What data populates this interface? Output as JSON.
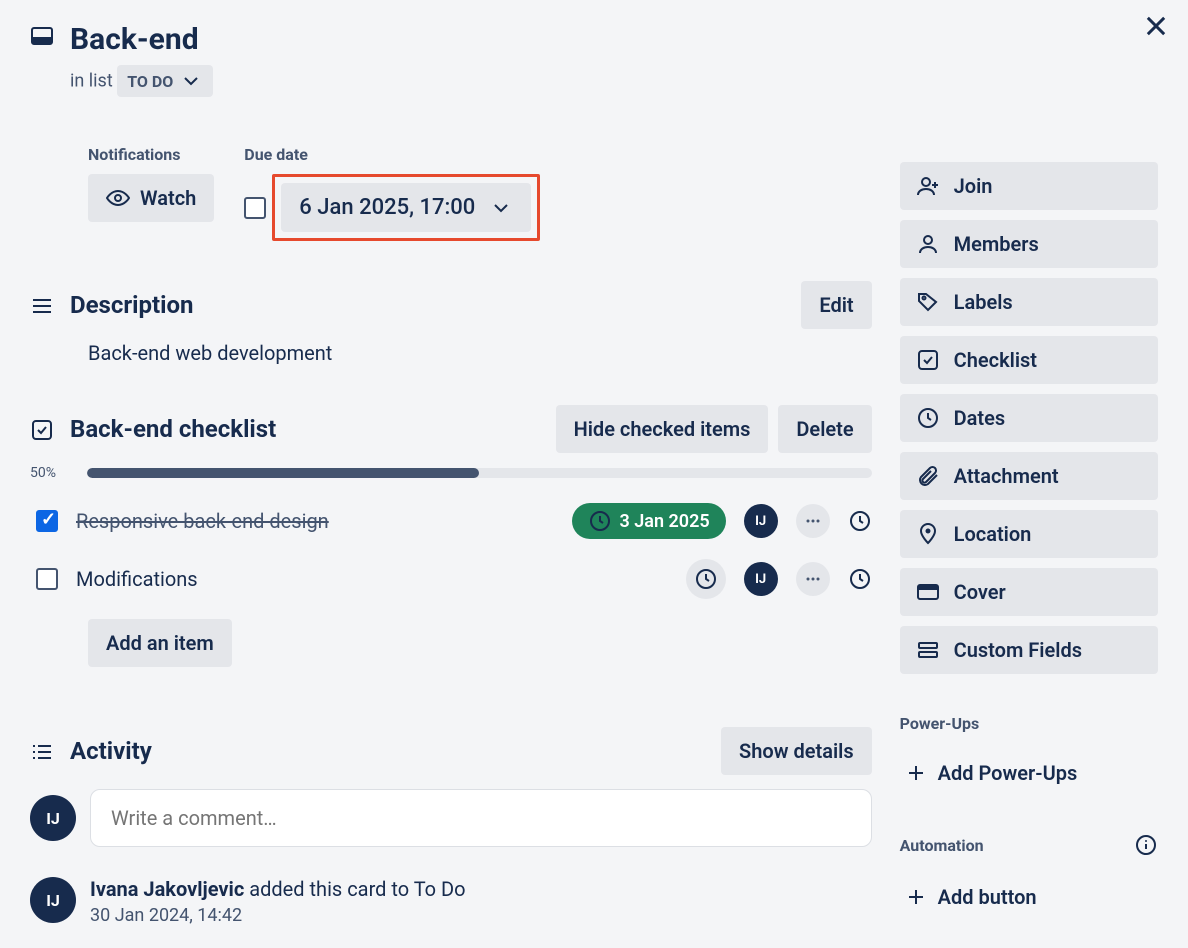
{
  "card": {
    "title": "Back-end",
    "in_list_prefix": "in list",
    "list_name": "TO DO"
  },
  "fields": {
    "notifications_label": "Notifications",
    "watch_label": "Watch",
    "due_label": "Due date",
    "due_value": "6 Jan 2025, 17:00"
  },
  "description": {
    "heading": "Description",
    "edit_label": "Edit",
    "text": "Back-end web development"
  },
  "checklist": {
    "title": "Back-end checklist",
    "hide_label": "Hide checked items",
    "delete_label": "Delete",
    "progress_pct": "50%",
    "progress_value": 50,
    "items": [
      {
        "text": "Responsive back-end design",
        "done": true,
        "date": "3 Jan 2025",
        "assignee": "IJ"
      },
      {
        "text": "Modifications",
        "done": false,
        "date": "",
        "assignee": "IJ"
      }
    ],
    "add_item_label": "Add an item"
  },
  "activity": {
    "heading": "Activity",
    "show_details_label": "Show details",
    "comment_placeholder": "Write a comment…",
    "avatar_initials": "IJ",
    "entries": [
      {
        "name": "Ivana Jakovljevic",
        "action": " added this card to To Do",
        "time": "30 Jan 2024, 14:42"
      }
    ]
  },
  "sidebar": {
    "join": "Join",
    "members": "Members",
    "labels": "Labels",
    "checklist": "Checklist",
    "dates": "Dates",
    "attachment": "Attachment",
    "location": "Location",
    "cover": "Cover",
    "custom_fields": "Custom Fields",
    "powerups_heading": "Power-Ups",
    "add_powerups": "Add Power-Ups",
    "automation_heading": "Automation",
    "add_button": "Add button"
  }
}
